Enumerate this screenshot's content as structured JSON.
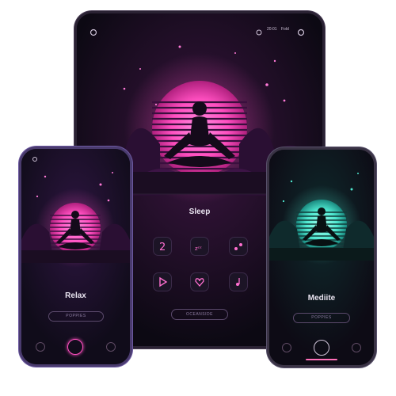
{
  "tablet": {
    "status_left_icon": "circle-icon",
    "status_time": "20:01",
    "status_extra": "Fold",
    "title": "Sleep",
    "button_label": "OCEANSIDE",
    "grid_icons": [
      "moon-icon",
      "zzz-icon",
      "music-notes-icon",
      "play-icon",
      "heart-icon",
      "note-icon"
    ],
    "accent": "#ff4fc0"
  },
  "phone_left": {
    "title": "Relax",
    "button_label": "POPPIES",
    "nav_icons": [
      "back-icon",
      "home-icon",
      "settings-icon"
    ],
    "accent": "#ff4fc0"
  },
  "phone_right": {
    "title": "Mediite",
    "button_label": "POPPIES",
    "nav_icons": [
      "plus-icon",
      "home-icon",
      "star-icon"
    ],
    "accent": "#4fe8d0"
  }
}
